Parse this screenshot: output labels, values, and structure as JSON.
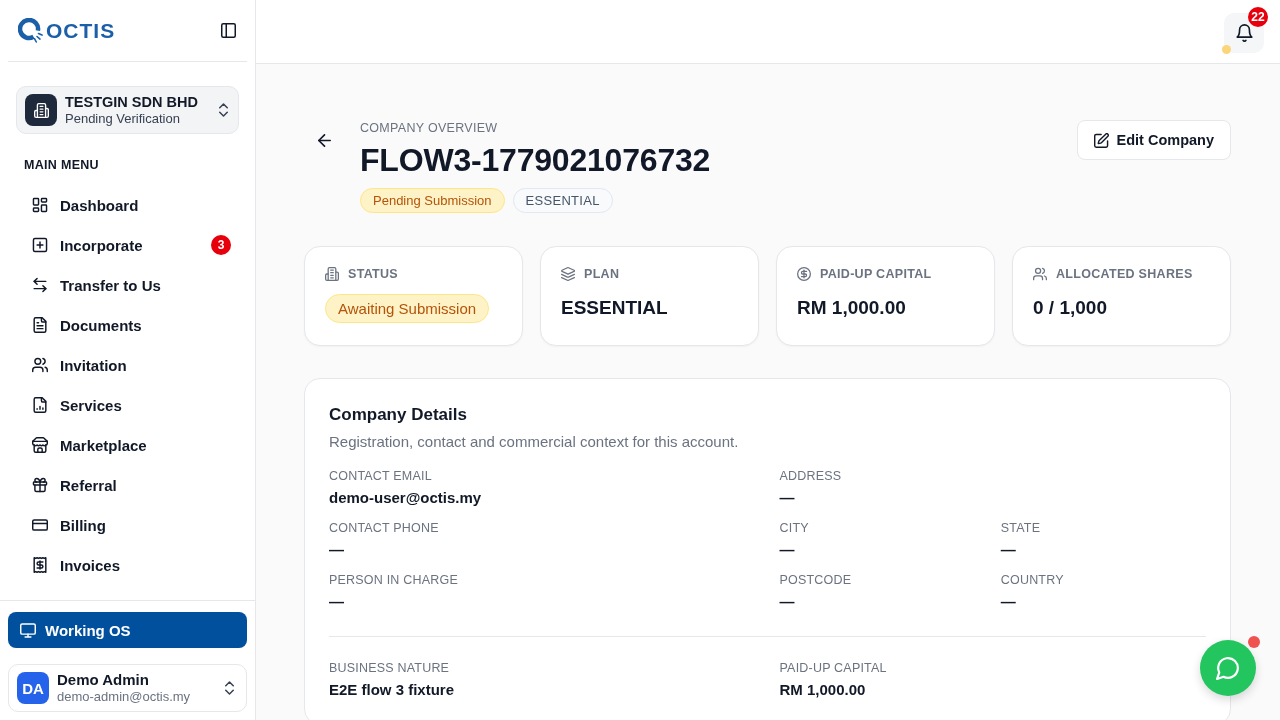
{
  "sidebar": {
    "logo": "OCTIS",
    "company": {
      "name": "TESTGIN SDN BHD",
      "status": "Pending Verification"
    },
    "section_title": "MAIN MENU",
    "menu_items": [
      {
        "label": "Dashboard",
        "selected": false
      },
      {
        "label": "Incorporate",
        "selected": false,
        "badge": "3"
      },
      {
        "label": "Transfer to Us",
        "selected": false
      },
      {
        "label": "Documents",
        "selected": false
      },
      {
        "label": "Invitation",
        "selected": false
      },
      {
        "label": "Services",
        "selected": false
      },
      {
        "label": "Marketplace",
        "selected": false
      },
      {
        "label": "Referral",
        "selected": false
      },
      {
        "label": "Billing",
        "selected": false
      },
      {
        "label": "Invoices",
        "selected": false
      }
    ],
    "working_os": "Working OS",
    "user": {
      "initials": "DA",
      "name": "Demo Admin",
      "email": "demo-admin@octis.my"
    }
  },
  "topbar": {
    "notification_count": "22"
  },
  "page_header": {
    "overline": "COMPANY OVERVIEW",
    "title": "FLOW3-1779021076732",
    "badges": [
      {
        "label": "Pending Submission",
        "kind": "warning"
      },
      {
        "label": "ESSENTIAL",
        "kind": "neutral"
      }
    ],
    "edit_button": "Edit Company"
  },
  "summary_cards": [
    {
      "label": "STATUS",
      "kind": "badge",
      "value": "Awaiting Submission"
    },
    {
      "label": "PLAN",
      "kind": "text",
      "value": "ESSENTIAL"
    },
    {
      "label": "PAID-UP CAPITAL",
      "kind": "text",
      "value": "RM 1,000.00"
    },
    {
      "label": "ALLOCATED SHARES",
      "kind": "text",
      "value": "0 / 1,000"
    }
  ],
  "company_details": {
    "title": "Company Details",
    "subtitle": "Registration, contact and commercial context for this account.",
    "sections": [
      {
        "rows": [
          {
            "fields": [
              {
                "label": "CONTACT EMAIL",
                "value": "demo-user@octis.my"
              },
              {
                "label": "ADDRESS",
                "value": "—"
              }
            ]
          },
          {
            "fields": [
              {
                "label": "CONTACT PHONE",
                "value": "—"
              },
              {
                "label": "CITY",
                "value": "—"
              },
              {
                "label": "STATE",
                "value": "—"
              }
            ]
          },
          {
            "fields": [
              {
                "label": "PERSON IN CHARGE",
                "value": "—"
              },
              {
                "label": "POSTCODE",
                "value": "—"
              },
              {
                "label": "COUNTRY",
                "value": "—"
              }
            ]
          }
        ]
      },
      {
        "rows": [
          {
            "fields": [
              {
                "label": "BUSINESS NATURE",
                "value": "E2E flow 3 fixture"
              },
              {
                "label": "PAID-UP CAPITAL",
                "value": "RM 1,000.00"
              }
            ]
          }
        ]
      }
    ]
  }
}
